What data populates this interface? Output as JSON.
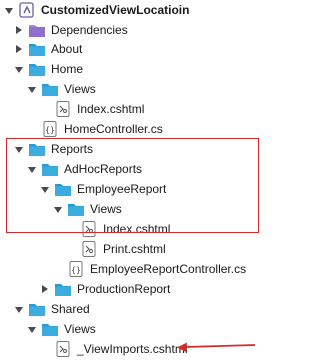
{
  "tree": {
    "rows": [
      {
        "label": "CustomizedViewLocatioin",
        "type": "solution",
        "expand": "down"
      },
      {
        "label": "Dependencies",
        "type": "deps",
        "expand": "right"
      },
      {
        "label": "About",
        "type": "folder",
        "expand": "right"
      },
      {
        "label": "Home",
        "type": "folder",
        "expand": "down"
      },
      {
        "label": "Views",
        "type": "folder",
        "expand": "down"
      },
      {
        "label": "Index.cshtml",
        "type": "cshtml",
        "expand": "none"
      },
      {
        "label": "HomeController.cs",
        "type": "cs",
        "expand": "none"
      },
      {
        "label": "Reports",
        "type": "folder",
        "expand": "down"
      },
      {
        "label": "AdHocReports",
        "type": "folder",
        "expand": "down"
      },
      {
        "label": "EmployeeReport",
        "type": "folder",
        "expand": "down"
      },
      {
        "label": "Views",
        "type": "folder",
        "expand": "down"
      },
      {
        "label": "Index.cshtml",
        "type": "cshtml",
        "expand": "none"
      },
      {
        "label": "Print.cshtml",
        "type": "cshtml",
        "expand": "none"
      },
      {
        "label": "EmployeeReportController.cs",
        "type": "cs",
        "expand": "none"
      },
      {
        "label": "ProductionReport",
        "type": "folder",
        "expand": "right"
      },
      {
        "label": "Shared",
        "type": "folder",
        "expand": "down"
      },
      {
        "label": "Views",
        "type": "folder",
        "expand": "down"
      },
      {
        "label": "_ViewImports.cshtml",
        "type": "cshtml",
        "expand": "none"
      }
    ]
  },
  "colors": {
    "folder": "#3bace0",
    "folder_tab": "#2a9bd0",
    "annotation": "#d42a2a",
    "solution_icon": "#6b5aa8"
  }
}
